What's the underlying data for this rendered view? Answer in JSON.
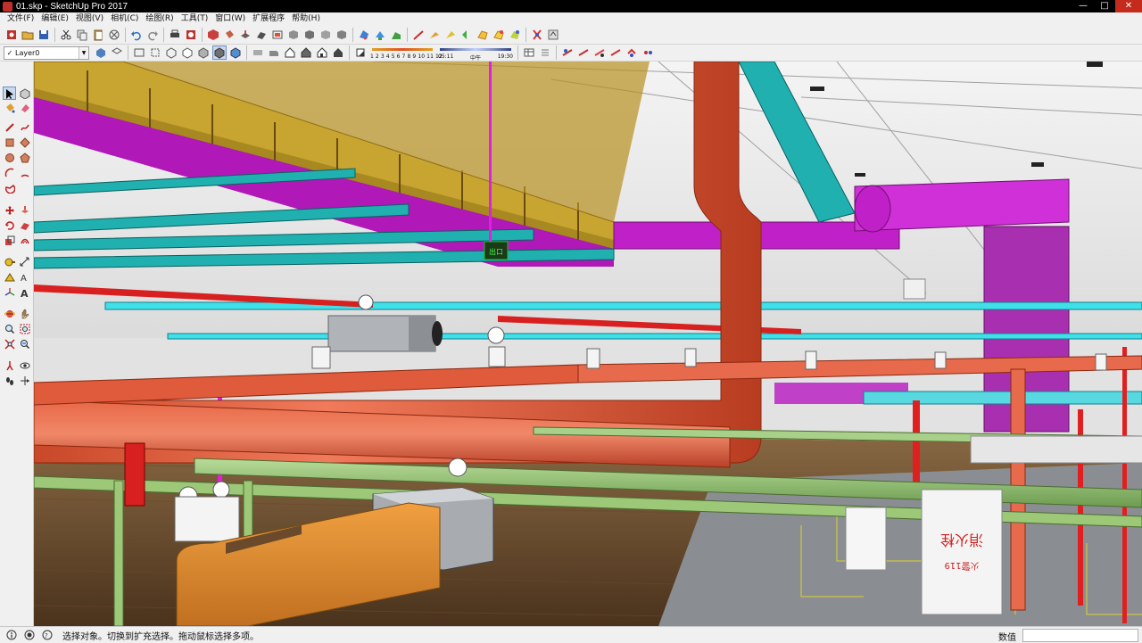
{
  "window": {
    "title": "01.skp - SketchUp Pro 2017"
  },
  "menu": {
    "items": [
      "文件(F)",
      "编辑(E)",
      "视图(V)",
      "相机(C)",
      "绘图(R)",
      "工具(T)",
      "窗口(W)",
      "扩展程序",
      "帮助(H)"
    ]
  },
  "layers": {
    "current": "Layer0"
  },
  "shadow_settings": {
    "month_labels": "1 2 3 4 5 6 7 8 9 10 11 12",
    "time_start": "05:11",
    "time_noon": "中午",
    "time_end": "19:30"
  },
  "viewport": {
    "sign_exit": "出口",
    "sign_hydrant_title": "消火栓",
    "sign_hydrant_sub": "火警119"
  },
  "status": {
    "message": "选择对象。切换到扩充选择。拖动鼠标选择多项。",
    "measure_label": "数值",
    "measure_value": ""
  },
  "colors": {
    "duct_yellow": "#c8a430",
    "duct_magenta": "#c020c8",
    "cable_tray_cyan": "#20b0b0",
    "pipe_orange": "#e85c40",
    "pipe_green": "#90c070",
    "duct_orange": "#e09030"
  }
}
